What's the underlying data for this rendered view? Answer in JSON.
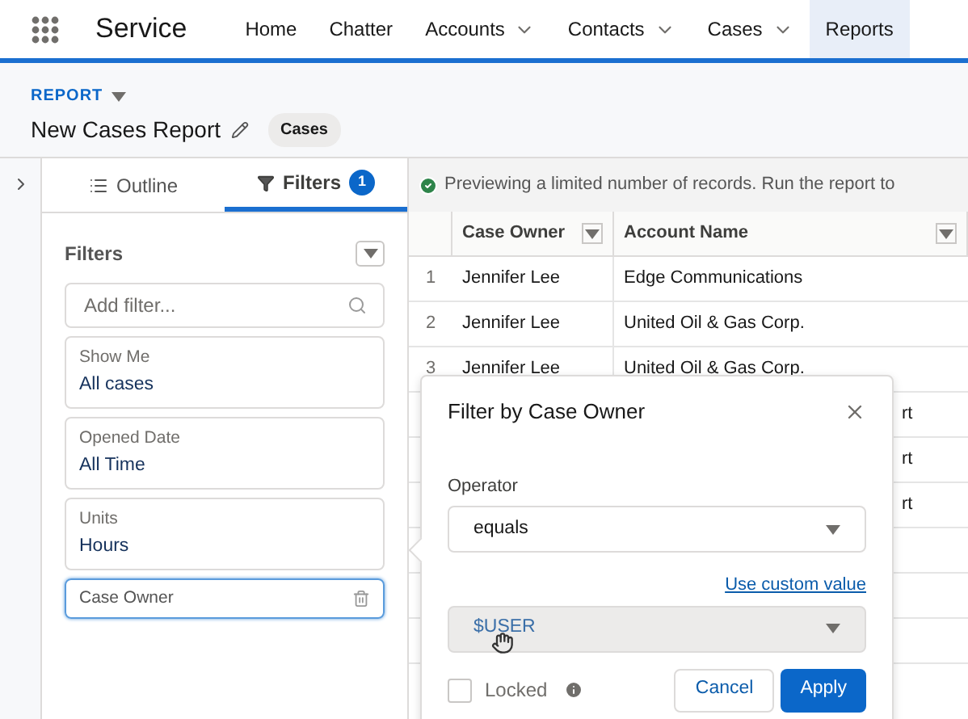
{
  "app": {
    "name": "Service"
  },
  "nav": [
    {
      "label": "Home",
      "dropdown": false,
      "selected": false
    },
    {
      "label": "Chatter",
      "dropdown": false,
      "selected": false
    },
    {
      "label": "Accounts",
      "dropdown": true,
      "selected": false
    },
    {
      "label": "Contacts",
      "dropdown": true,
      "selected": false
    },
    {
      "label": "Cases",
      "dropdown": true,
      "selected": false
    },
    {
      "label": "Reports",
      "dropdown": false,
      "selected": true
    }
  ],
  "header": {
    "eyebrow": "REPORT",
    "title": "New Cases Report",
    "badge": "Cases"
  },
  "panel_tabs": [
    {
      "label": "Outline",
      "selected": false
    },
    {
      "label": "Filters",
      "count": "1",
      "selected": true
    }
  ],
  "filters": {
    "heading": "Filters",
    "search": {
      "placeholder": "Add filter..."
    },
    "items": [
      {
        "label": "Show Me",
        "value": "All cases",
        "active": false
      },
      {
        "label": "Opened Date",
        "value": "All Time",
        "active": false
      },
      {
        "label": "Units",
        "value": "Hours",
        "active": false
      },
      {
        "label": "Case Owner",
        "active": true
      }
    ]
  },
  "notice": "Previewing a limited number of records. Run the report to",
  "table": {
    "columns": [
      "Case Owner",
      "Account Name"
    ],
    "rows": [
      {
        "index": "1",
        "owner": "Jennifer Lee",
        "account": "Edge Communications"
      },
      {
        "index": "2",
        "owner": "Jennifer Lee",
        "account": "United Oil & Gas Corp."
      },
      {
        "index": "3",
        "owner": "Jennifer Lee",
        "account": "United Oil & Gas Corp."
      },
      {
        "account": "rt"
      },
      {
        "account": "rt"
      },
      {
        "account": "rt"
      },
      {},
      {},
      {}
    ]
  },
  "popover": {
    "title": "Filter by Case Owner",
    "operator_label": "Operator",
    "operator": "equals",
    "link": "Use custom value",
    "value": "$USER",
    "locked": {
      "label": "Locked",
      "checked": false
    },
    "buttons": [
      "Cancel",
      "Apply"
    ]
  }
}
